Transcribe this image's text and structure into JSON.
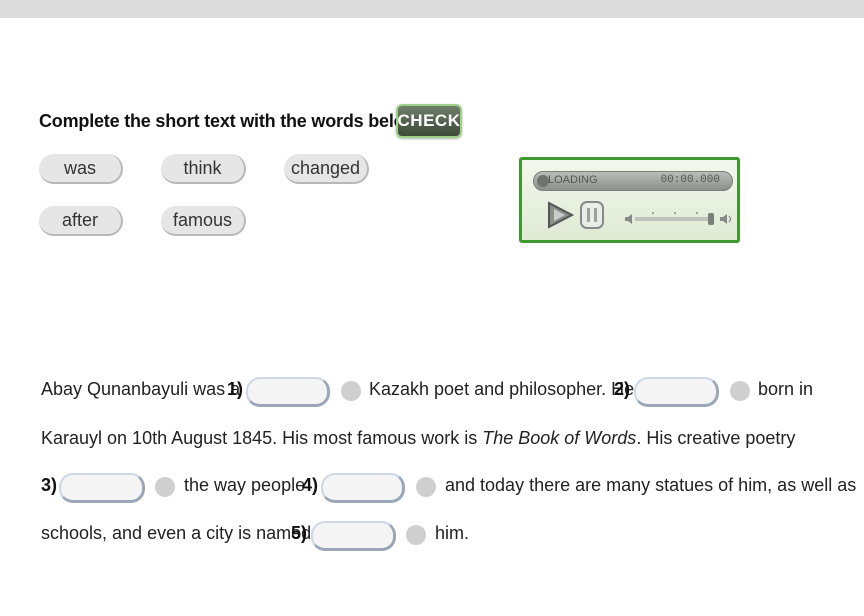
{
  "instruction": "Complete the short text with the words below.",
  "check_label": "CHECK",
  "word_bank": [
    "was",
    "think",
    "changed",
    "after",
    "famous"
  ],
  "player": {
    "loading_label": "LOADING",
    "time": "00:00.000",
    "play_icon": "play-icon",
    "pause_icon": "pause-icon",
    "volume_icon": "volume-icon"
  },
  "passage": {
    "line1_a": "Abay Qunanbayuli was a",
    "line1_n1": "1)",
    "line1_b": "Kazakh poet and philosopher. He",
    "line1_n2": "2)",
    "line1_c": "born in",
    "line2_a": "Karauyl on 10th August 1845. His most famous work is",
    "line2_title": "The Book of Words",
    "line2_b": ". His creative poetry",
    "line3_n3": "3)",
    "line3_a": "the way people",
    "line3_n4": "4)",
    "line3_b": "and today there are many statues of him, as well as",
    "line4_a": "schools, and even a city is named",
    "line4_n5": "5)",
    "line4_b": "him."
  }
}
